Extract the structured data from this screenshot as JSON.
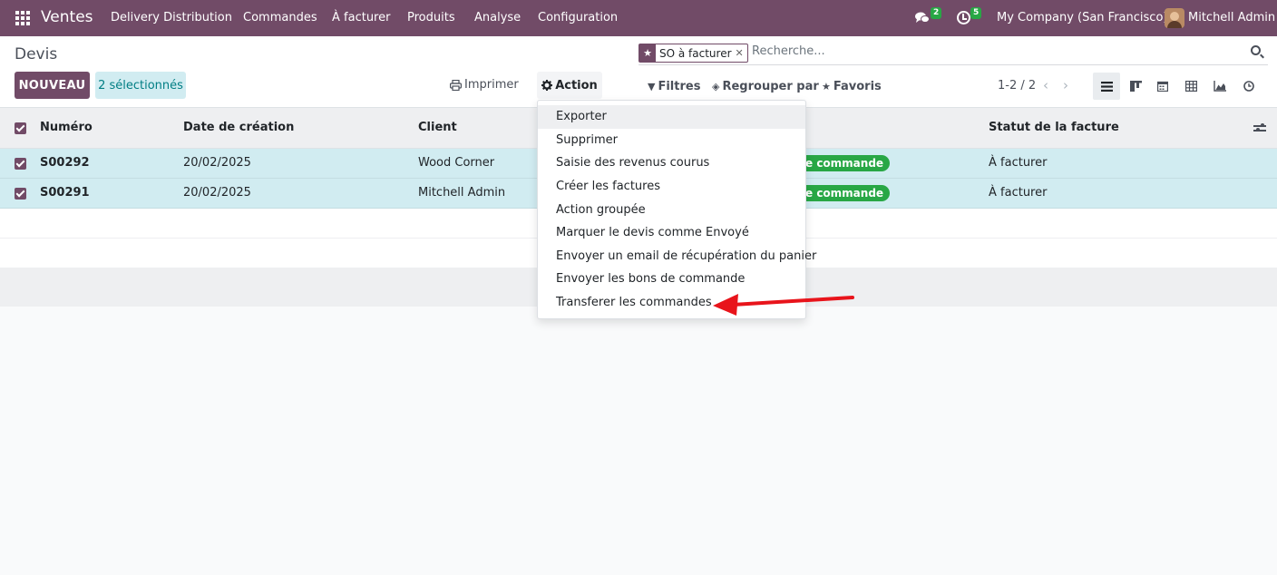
{
  "navbar": {
    "brand": "Ventes",
    "menu": [
      "Delivery Distribution",
      "Commandes",
      "À facturer",
      "Produits",
      "Analyse",
      "Configuration"
    ],
    "messages_count": "2",
    "activities_count": "5",
    "company": "My Company (San Francisco)",
    "user": "Mitchell Admin",
    "colors": {
      "navbar_bg": "#714b67",
      "badge": "#28a745"
    }
  },
  "control": {
    "title": "Devis",
    "new_button": "NOUVEAU",
    "selected_label": "2 sélectionnés",
    "print_label": "Imprimer",
    "action_label": "Action",
    "search": {
      "facet": "SO à facturer",
      "placeholder": "Recherche..."
    },
    "filters_label": "Filtres",
    "groupby_label": "Regrouper par",
    "favorites_label": "Favoris",
    "pager": "1-2 / 2",
    "views": [
      "list-view-icon",
      "kanban-view-icon",
      "calendar-view-icon",
      "pivot-view-icon",
      "graph-view-icon",
      "activity-view-icon"
    ]
  },
  "table": {
    "columns": [
      "Numéro",
      "Date de création",
      "Client",
      "",
      "Statut de la facture"
    ],
    "rows": [
      {
        "number": "S00292",
        "date": "20/02/2025",
        "client": "Wood Corner",
        "status": "e commande",
        "invoice_status": "À facturer"
      },
      {
        "number": "S00291",
        "date": "20/02/2025",
        "client": "Mitchell Admin",
        "status": "e commande",
        "invoice_status": "À facturer"
      }
    ]
  },
  "action_menu": {
    "items": [
      "Exporter",
      "Supprimer",
      "Saisie des revenus courus",
      "Créer les factures",
      "Action groupée",
      "Marquer le devis comme Envoyé",
      "Envoyer un email de récupération du panier",
      "Envoyer les bons de commande",
      "Transferer les commandes"
    ],
    "highlighted": "Exporter"
  },
  "annotation": {
    "arrow_color": "#e8141b",
    "points_to": "Transferer les commandes"
  }
}
